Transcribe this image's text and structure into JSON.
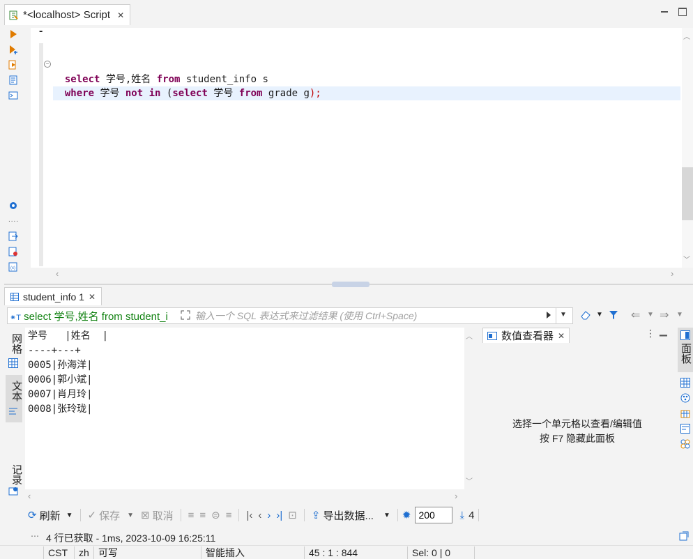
{
  "editor_tab": {
    "title": "*<localhost> Script",
    "close": "✕"
  },
  "code": {
    "line1": [
      "select",
      " 学号,姓名 ",
      "from",
      " student_info s"
    ],
    "line2": [
      "where",
      " 学号 ",
      "not",
      " ",
      "in",
      " (",
      "select",
      " 学号 ",
      "from",
      " grade g",
      ");"
    ],
    "cursor": "-"
  },
  "results_tab": {
    "label": "student_info 1",
    "close": "✕"
  },
  "filter": {
    "query": "select 学号,姓名 from student_i",
    "placeholder": "输入一个 SQL 表达式来过滤结果 (使用 Ctrl+Space)"
  },
  "grid": {
    "header": "学号   |姓名  |",
    "separator": "----+---+",
    "rows": [
      "0005|孙海洋|",
      "0006|郭小斌|",
      "0007|肖月玲|",
      "0008|张玲珑|"
    ]
  },
  "side_tabs": {
    "grid": "网格",
    "text": "文本",
    "record": "记录"
  },
  "value_viewer": {
    "title": "数值查看器",
    "close": "✕",
    "hint_line1": "选择一个单元格以查看/编辑值",
    "hint_line2": "按 F7 隐藏此面板"
  },
  "right_tabs": {
    "panels": "面板"
  },
  "toolbar": {
    "refresh": "刷新",
    "save": "保存",
    "cancel": "取消",
    "export": "导出数据...",
    "fetch_size": "200",
    "row_count": "4"
  },
  "fetch_status": "4 行已获取 - 1ms, 2023-10-09 16:25:11",
  "statusbar": {
    "timezone": "CST",
    "locale": "zh",
    "mode": "可写",
    "insert": "智能插入",
    "position": "45 : 1 : 844",
    "selection": "Sel: 0 | 0"
  },
  "colors": {
    "keyword": "#7f0055",
    "accent": "#1f6fd1",
    "filter_query": "#128212",
    "current_line": "#e8f2fe"
  }
}
